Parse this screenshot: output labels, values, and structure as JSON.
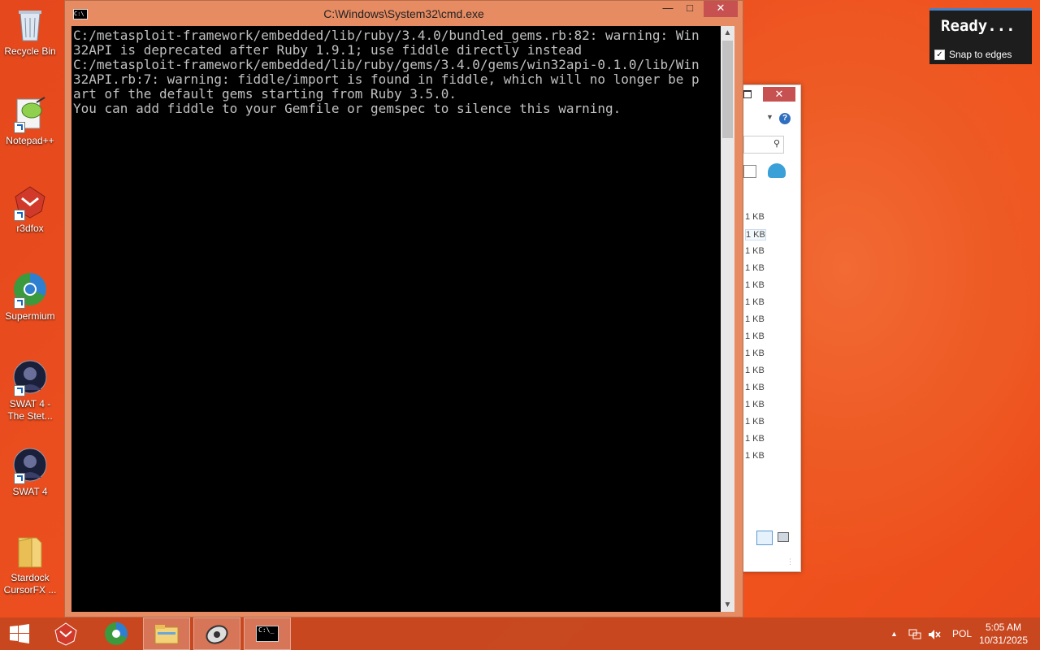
{
  "desktop": {
    "icons": [
      {
        "label": "Recycle Bin"
      },
      {
        "label": "Notepad++"
      },
      {
        "label": "r3dfox"
      },
      {
        "label": "Supermium"
      },
      {
        "label": "SWAT 4 - The Stet..."
      },
      {
        "label": "SWAT 4"
      },
      {
        "label": "Stardock CursorFX ..."
      }
    ]
  },
  "cmd_window": {
    "title": "C:\\Windows\\System32\\cmd.exe",
    "icon_text": "C:\\",
    "minimize": "—",
    "maximize": "□",
    "close": "✕",
    "console_lines": "C:/metasploit-framework/embedded/lib/ruby/3.4.0/bundled_gems.rb:82: warning: Win\n32API is deprecated after Ruby 1.9.1; use fiddle directly instead\nC:/metasploit-framework/embedded/lib/ruby/gems/3.4.0/gems/win32api-0.1.0/lib/Win\n32API.rb:7: warning: fiddle/import is found in fiddle, which will no longer be p\nart of the default gems starting from Ruby 3.5.0.\nYou can add fiddle to your Gemfile or gemspec to silence this warning."
  },
  "explorer_window": {
    "close": "✕",
    "sizes": [
      "1 KB",
      "1 KB",
      "1 KB",
      "1 KB",
      "1 KB",
      "1 KB",
      "1 KB",
      "1 KB",
      "1 KB",
      "1 KB",
      "1 KB",
      "1 KB",
      "1 KB",
      "1 KB",
      "1 KB"
    ]
  },
  "snap_popup": {
    "status": "Ready...",
    "checkbox_label": "Snap to edges",
    "checked": true
  },
  "taskbar": {
    "language": "POL",
    "time": "5:05 AM",
    "date": "10/31/2025"
  },
  "colors": {
    "accent": "#e65a2a",
    "cmd_frame": "#e68b62",
    "console_bg": "#000000",
    "console_fg": "#c0c0c0"
  }
}
